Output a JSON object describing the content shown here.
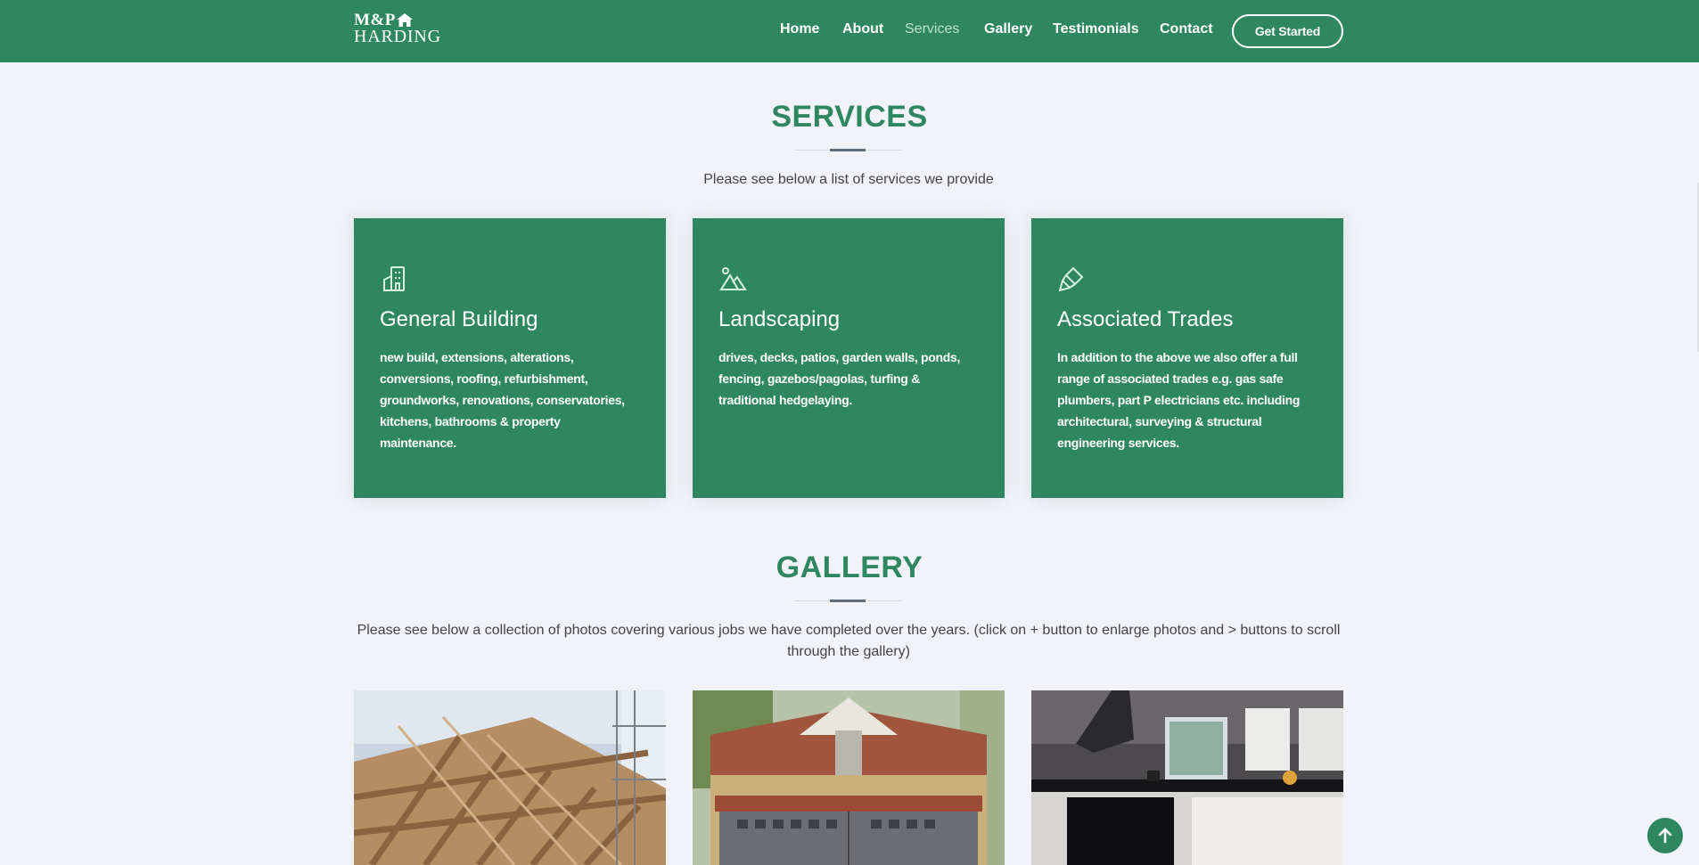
{
  "brand": {
    "line1": "M&P",
    "line2": "HARDING"
  },
  "nav": {
    "items": [
      {
        "label": "Home",
        "active": false
      },
      {
        "label": "About",
        "active": false
      },
      {
        "label": "Services",
        "active": true
      },
      {
        "label": "Gallery",
        "active": false
      },
      {
        "label": "Testimonials",
        "active": false
      },
      {
        "label": "Contact",
        "active": false
      }
    ],
    "cta_label": "Get Started"
  },
  "services": {
    "title": "SERVICES",
    "subtitle": "Please see below a list of services we provide",
    "cards": [
      {
        "icon": "building-icon",
        "title": "General Building",
        "text": "new build, extensions, alterations, conversions, roofing, refurbishment, groundworks, renovations, conservatories, kitchens, bathrooms & property maintenance."
      },
      {
        "icon": "landscape-icon",
        "title": "Landscaping",
        "text": "drives, decks, patios, garden walls, ponds, fencing, gazebos/pagolas, turfing & traditional hedgelaying."
      },
      {
        "icon": "paint-brush-icon",
        "title": "Associated Trades",
        "text": "In addition to the above we also offer a full range of associated trades e.g. gas safe plumbers, part P electricians etc. including architectural, surveying & structural engineering services."
      }
    ]
  },
  "gallery": {
    "title": "GALLERY",
    "subtitle": "Please see below a collection of photos covering various jobs we have completed over the years. (click on + button to enlarge photos and > buttons to scroll through the gallery)",
    "photos": [
      "roof-timber-frame-photo",
      "garage-building-photo",
      "kitchen-interior-photo"
    ]
  },
  "colors": {
    "brand_green": "#2e8761",
    "page_bg": "#f1f3f8",
    "divider_accent": "#5f6c79"
  },
  "back_to_top_icon": "arrow-up-icon"
}
